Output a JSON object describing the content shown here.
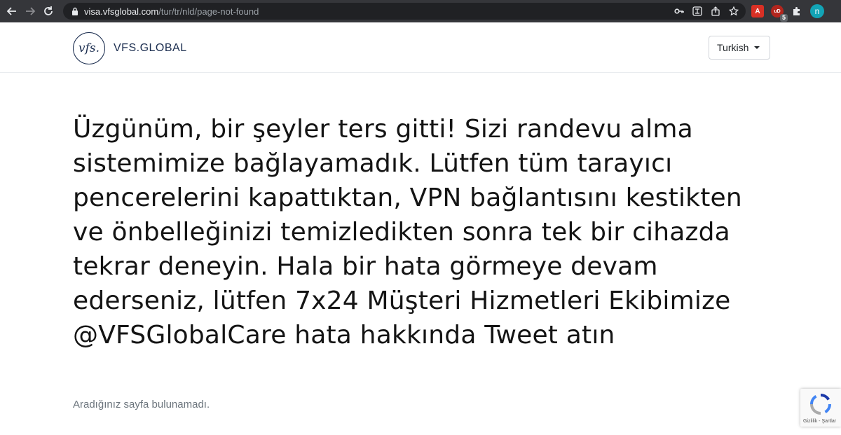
{
  "browser": {
    "url_host": "visa.vfsglobal.com",
    "url_path": "/tur/tr/nld/page-not-found",
    "extensions": {
      "pdf_label": "A",
      "ud_label": "uD",
      "ud_badge": "5"
    },
    "profile_initial": "n"
  },
  "header": {
    "logo_mark": "vfs.",
    "logo_text": "VFS.GLOBAL",
    "language": "Turkish"
  },
  "main": {
    "message": "Üzgünüm, bir şeyler ters gitti! Sizi randevu alma sistemimize bağlayamadık. Lütfen tüm tarayıcı pencerelerini kapattıktan, VPN bağlantısını kestikten ve önbelleğinizi temizledikten sonra tek bir cihazda tekrar deneyin. Hala bir hata görmeye devam ederseniz, lütfen 7x24 Müşteri Hizmetleri Ekibimize @VFSGlobalCare hata hakkında Tweet atın",
    "sub_message": "Aradığınız sayfa bulunamadı."
  },
  "recaptcha": {
    "links": "Gizlilik - Şartlar"
  },
  "colors": {
    "chrome_bg": "#35363a",
    "omnibox_bg": "#202124",
    "brand_navy": "#1b2d4f",
    "text_main": "#141414",
    "text_muted": "#6c757d"
  }
}
